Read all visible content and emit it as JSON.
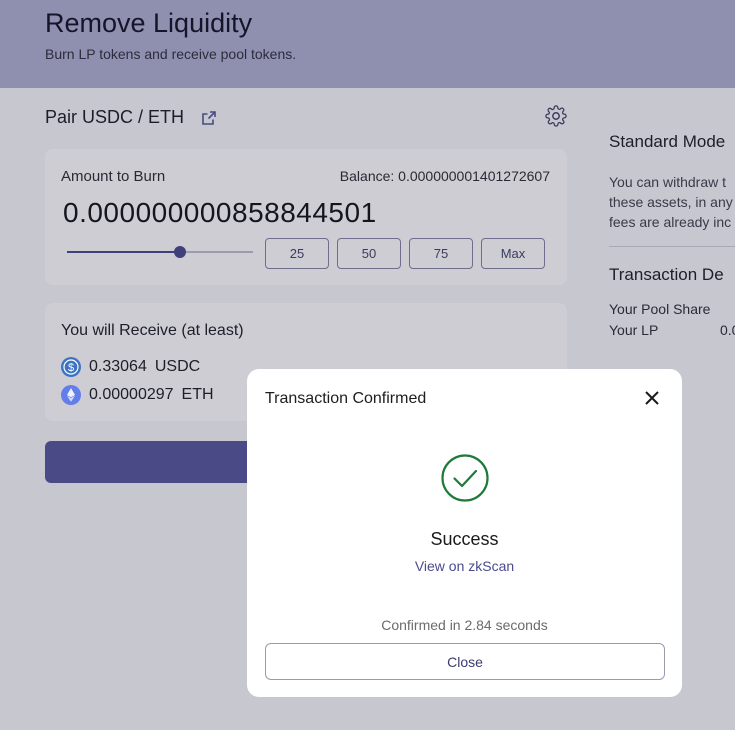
{
  "header": {
    "title": "Remove Liquidity",
    "subtitle": "Burn LP tokens and receive pool tokens."
  },
  "pair": {
    "label": "Pair USDC / ETH",
    "external_icon": "external-link-icon",
    "settings_icon": "gear-icon"
  },
  "burn": {
    "label": "Amount to Burn",
    "balance": "Balance: 0.000000001401272607",
    "amount": "0.000000000858844501",
    "slider_percent": 61,
    "buttons": [
      "25",
      "50",
      "75",
      "Max"
    ]
  },
  "receive": {
    "title": "You will Receive (at least)",
    "tokens": [
      {
        "amount": "0.33064",
        "symbol": "USDC",
        "icon": "usdc-icon",
        "color": "#3e73c4"
      },
      {
        "amount": "0.00000297",
        "symbol": "ETH",
        "icon": "eth-icon",
        "color": "#627eea"
      }
    ]
  },
  "right_panel": {
    "standard_title": "Standard Mode",
    "standard_lines": [
      "You can withdraw t",
      "these assets, in any",
      "fees are already inc"
    ],
    "details_title": "Transaction De",
    "pool_share_label": "Your Pool Share",
    "lp_label": "Your LP",
    "lp_value": "0.0"
  },
  "modal": {
    "title": "Transaction Confirmed",
    "success": "Success",
    "view_link": "View on zkScan",
    "confirmed": "Confirmed in 2.84 seconds",
    "close_button": "Close"
  },
  "colors": {
    "accent": "#4a4a86",
    "success": "#1d7a3a"
  }
}
